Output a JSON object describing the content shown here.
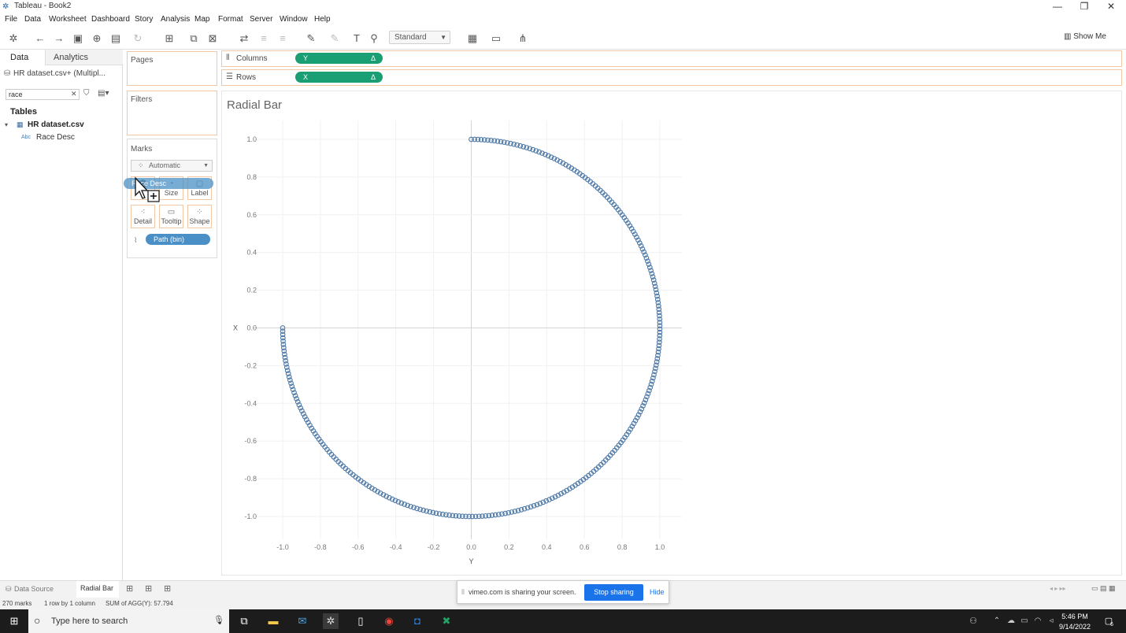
{
  "window": {
    "title": "Tableau - Book2"
  },
  "menu": [
    "File",
    "Data",
    "Worksheet",
    "Dashboard",
    "Story",
    "Analysis",
    "Map",
    "Format",
    "Server",
    "Window",
    "Help"
  ],
  "toolbar": {
    "fit_select": "Standard",
    "show_me": "Show Me"
  },
  "left_panel": {
    "tab_data": "Data",
    "tab_analytics": "Analytics",
    "datasource": "HR dataset.csv+ (Multipl...",
    "search_value": "race",
    "tables_heading": "Tables",
    "table_name": "HR dataset.csv",
    "field_type_abbr": "Abc",
    "field_name": "Race Desc"
  },
  "cards": {
    "pages": "Pages",
    "filters": "Filters",
    "marks": "Marks",
    "mark_type": "Automatic",
    "mark_buttons": {
      "size": "Size",
      "label": "Label",
      "detail": "Detail",
      "tooltip": "Tooltip",
      "shape": "Shape"
    },
    "dragging_pill": "Race Desc",
    "path_pill": "Path (bin)"
  },
  "shelves": {
    "columns_label": "Columns",
    "columns_pill": "Y",
    "rows_label": "Rows",
    "rows_pill": "X",
    "pill_delta": "Δ"
  },
  "sheet": {
    "title": "Radial Bar"
  },
  "bottom": {
    "data_source_tab": "Data Source",
    "sheet_tab": "Radial Bar",
    "status_marks": "270 marks",
    "status_rows": "1 row by 1 column",
    "status_sum": "SUM of AGG(Y): 57.794"
  },
  "vimeo": {
    "message": "vimeo.com is sharing your screen.",
    "stop": "Stop sharing",
    "hide": "Hide"
  },
  "taskbar": {
    "search_placeholder": "Type here to search",
    "time": "5:46 PM",
    "date": "9/14/2022",
    "notif_count": "6"
  },
  "colors": {
    "pill_green": "#1a9e74",
    "pill_blue": "#4a90c7",
    "mark_blue": "#4e79a7",
    "stop_blue": "#1a73e8"
  },
  "chart_data": {
    "type": "scatter",
    "title": "Radial Bar",
    "xlabel": "Y",
    "ylabel": "X",
    "xlim": [
      -1.1,
      1.1
    ],
    "ylim": [
      -1.1,
      1.1
    ],
    "xticks": [
      "-1.0",
      "-0.8",
      "-0.6",
      "-0.4",
      "-0.2",
      "0.0",
      "0.2",
      "0.4",
      "0.6",
      "0.8",
      "1.0"
    ],
    "yticks": [
      "1.0",
      "0.8",
      "0.6",
      "0.4",
      "0.2",
      "0.0",
      "-0.2",
      "-0.4",
      "-0.6",
      "-0.8",
      "-1.0"
    ],
    "series": [
      {
        "marks": 270,
        "shape": "circle",
        "start_angle_deg": 90,
        "sweep_deg": 270,
        "radius": 1.0,
        "direction": "clockwise"
      }
    ],
    "grid": true
  }
}
